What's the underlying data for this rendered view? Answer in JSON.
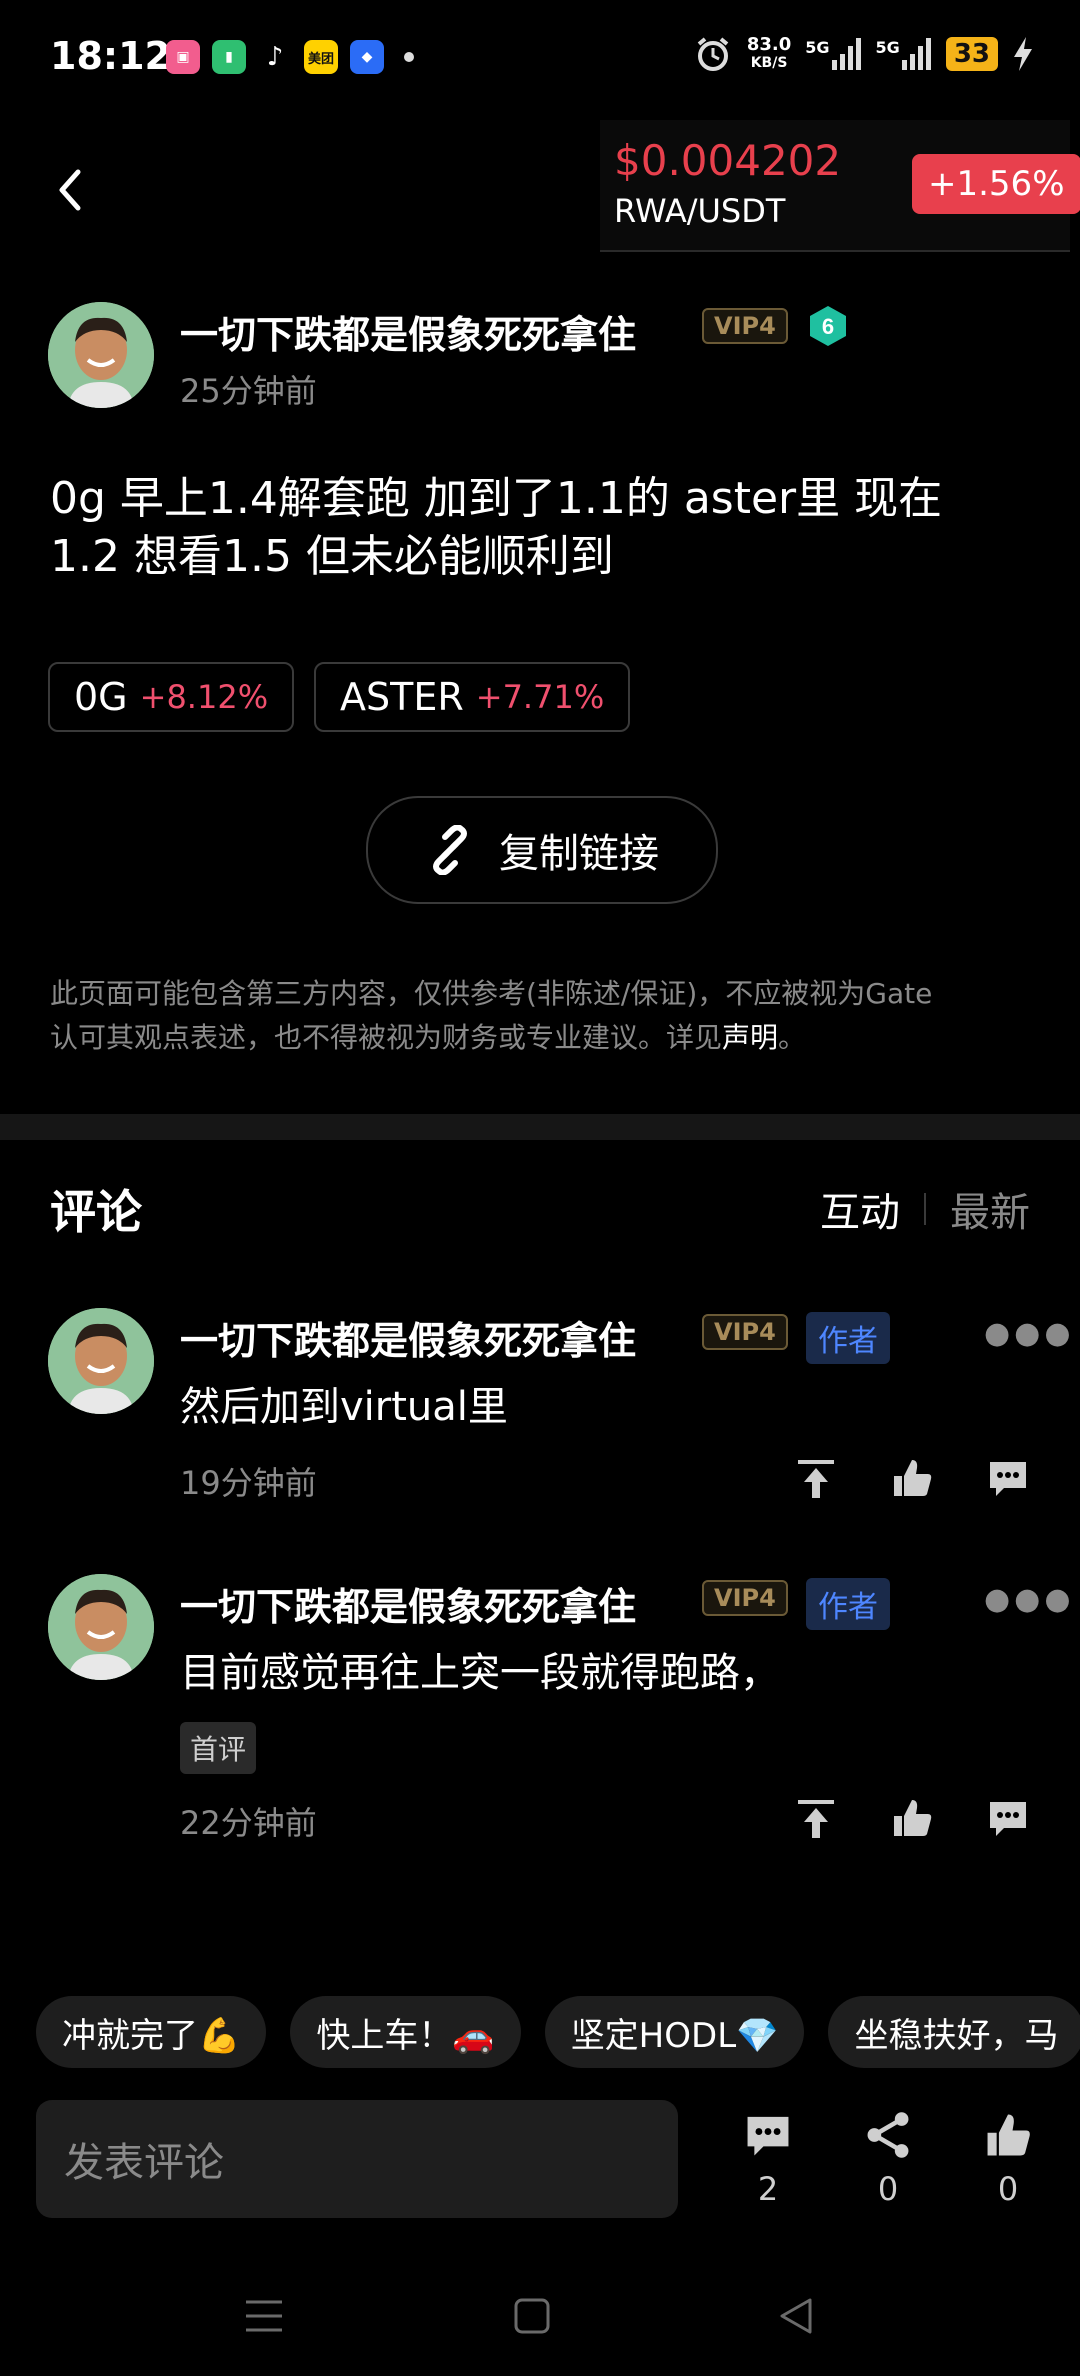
{
  "status_bar": {
    "time": "18:12",
    "net_speed_value": "83.0",
    "net_speed_unit": "KB/S",
    "signal1": "5G",
    "signal2": "5G",
    "battery": "33",
    "apps": [
      "bilibili",
      "battery-app",
      "tiktok",
      "meituan",
      "browser"
    ],
    "meituan_label": "美团"
  },
  "ticker": {
    "price": "$0.004202",
    "pair": "RWA/USDT",
    "change": "+1.56%"
  },
  "post": {
    "author": "一切下跌都是假象死死拿住",
    "vip": "VIP4",
    "level": "6",
    "time": "25分钟前",
    "text_line1": "0g 早上1.4解套跑  加到了1.1的 aster里  现在",
    "text_line2": "1.2 想看1.5 但未必能顺利到",
    "tags": [
      {
        "symbol": "0G",
        "change": "+8.12%"
      },
      {
        "symbol": "ASTER",
        "change": "+7.71%"
      }
    ],
    "copy_link": "复制链接",
    "disclaimer_line1": "此页面可能包含第三方内容，仅供参考(非陈述/保证)，不应被视为Gate",
    "disclaimer_line2": "认可其观点表述，也不得被视为财务或专业建议。详见",
    "disclaimer_link": "声明",
    "disclaimer_end": "。"
  },
  "comments_section": {
    "title": "评论",
    "sort_active": "互动",
    "sort_other": "最新",
    "items": [
      {
        "author": "一切下跌都是假象死死拿住",
        "vip": "VIP4",
        "badge": "作者",
        "text": "然后加到virtual里",
        "time": "19分钟前"
      },
      {
        "author": "一切下跌都是假象死死拿住",
        "vip": "VIP4",
        "badge": "作者",
        "text": "目前感觉再往上突一段就得跑路，",
        "first_tag": "首评",
        "time": "22分钟前"
      }
    ]
  },
  "quick_replies": [
    "冲就完了💪",
    "快上车！🚗",
    "坚定HODL💎",
    "坐稳扶好，马"
  ],
  "bottom_bar": {
    "input_placeholder": "发表评论",
    "comment_count": "2",
    "share_count": "0",
    "like_count": "0"
  }
}
